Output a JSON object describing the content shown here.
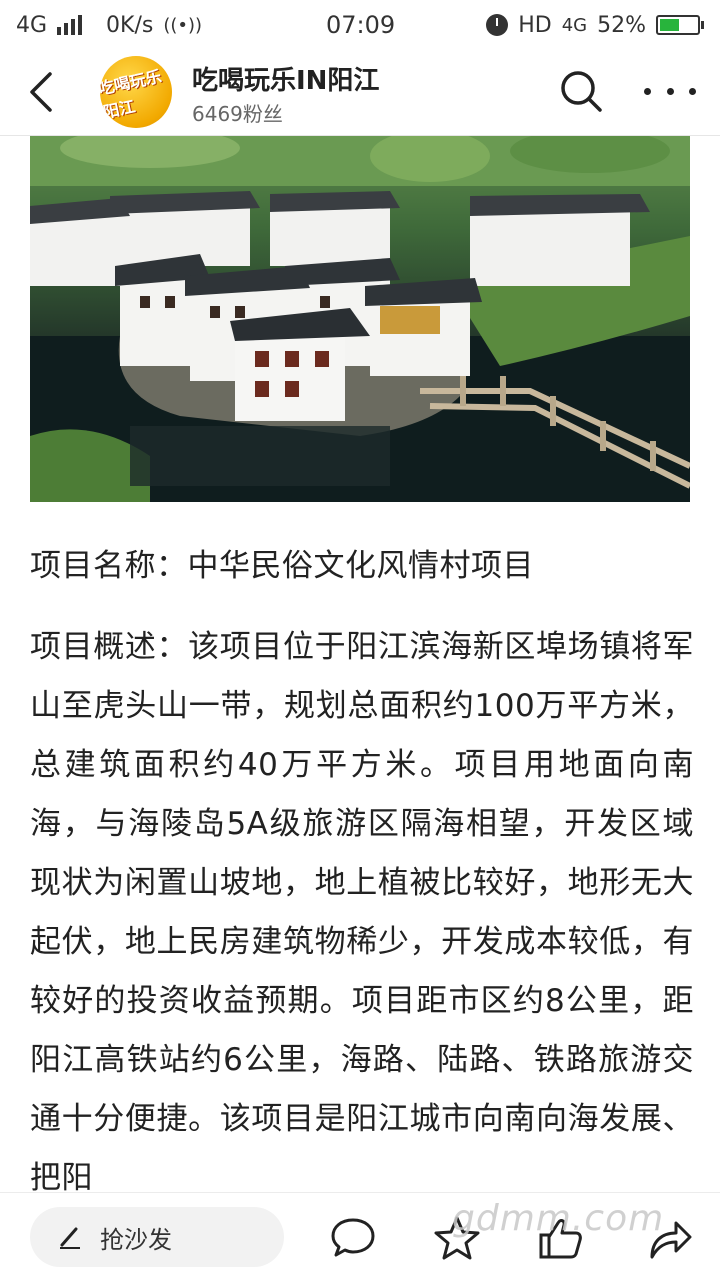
{
  "status_bar": {
    "network": "4G",
    "speed": "0K/s",
    "time": "07:09",
    "hd": "HD",
    "network2": "4G",
    "battery": "52%",
    "battery_level": 0.52,
    "battery_color": "#28b43c"
  },
  "header": {
    "account_name": "吃喝玩乐IN阳江",
    "fans": "6469粉丝",
    "avatar_text": "吃喝玩乐阳江",
    "icons": [
      "back-arrow-icon",
      "search-icon",
      "more-dots-icon"
    ]
  },
  "photo": {
    "description_icon": "village-photo"
  },
  "article": {
    "project_name": "项目名称：中华民俗文化风情村项目",
    "overview": "项目概述：该项目位于阳江滨海新区埠场镇将军山至虎头山一带，规划总面积约100万平方米，总建筑面积约40万平方米。项目用地面向南海，与海陵岛5A级旅游区隔海相望，开发区域现状为闲置山坡地，地上植被比较好，地形无大起伏，地上民房建筑物稀少，开发成本较低，有较好的投资收益预期。项目距市区约8公里，距阳江高铁站约6公里，海路、陆路、铁路旅游交通十分便捷。该项目是阳江城市向南向海发展、把阳"
  },
  "bottom_bar": {
    "comment_placeholder": "抢沙发",
    "watermark": "gdmm.com",
    "icons": [
      "pen-icon",
      "comment-icon",
      "star-icon",
      "like-icon",
      "share-icon"
    ]
  }
}
